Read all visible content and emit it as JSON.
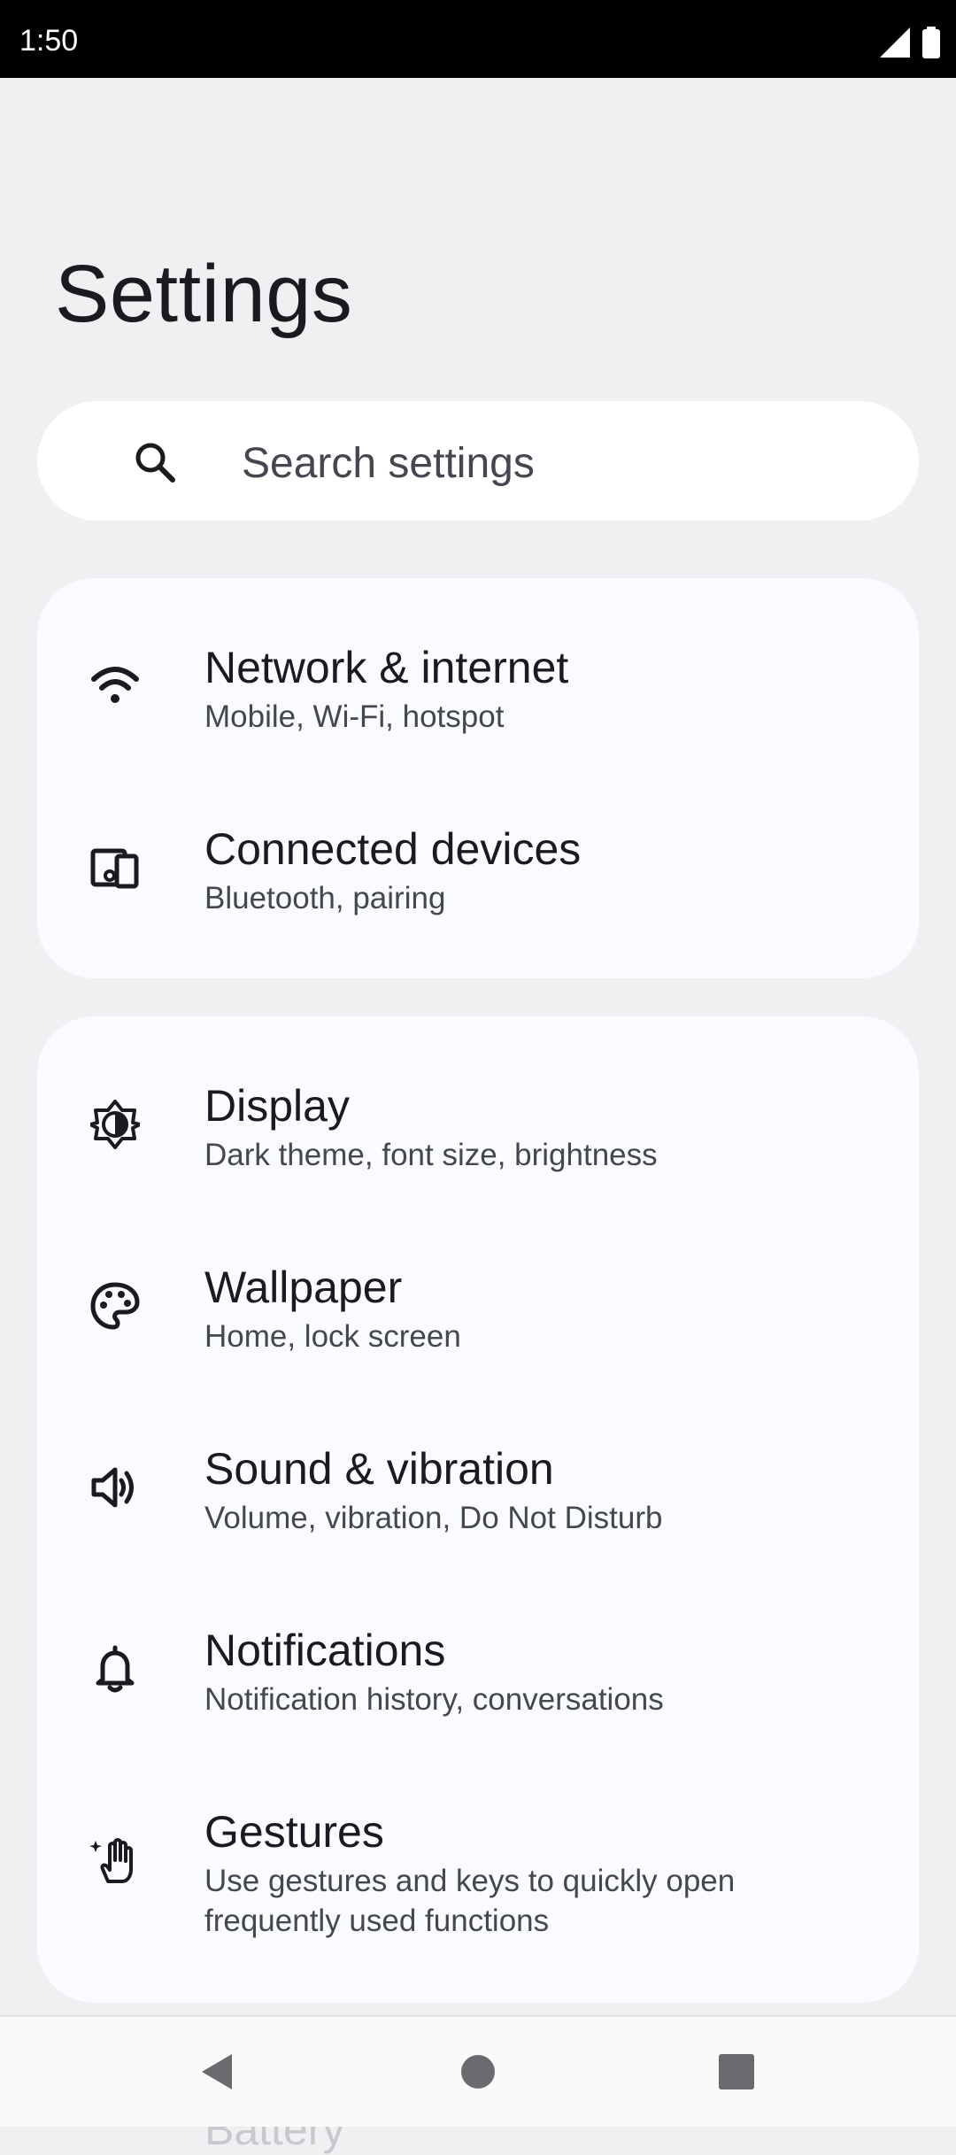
{
  "status_bar": {
    "time": "1:50",
    "icons": [
      "signal-icon",
      "battery-icon"
    ]
  },
  "page": {
    "title": "Settings"
  },
  "search": {
    "placeholder": "Search settings",
    "icon": "search-icon"
  },
  "groups": [
    {
      "items": [
        {
          "icon": "wifi-icon",
          "title": "Network & internet",
          "subtitle": "Mobile, Wi-Fi, hotspot"
        },
        {
          "icon": "devices-icon",
          "title": "Connected devices",
          "subtitle": "Bluetooth, pairing"
        }
      ]
    },
    {
      "items": [
        {
          "icon": "brightness-icon",
          "title": "Display",
          "subtitle": "Dark theme, font size, brightness"
        },
        {
          "icon": "palette-icon",
          "title": "Wallpaper",
          "subtitle": "Home, lock screen"
        },
        {
          "icon": "speaker-icon",
          "title": "Sound & vibration",
          "subtitle": "Volume, vibration, Do Not Disturb"
        },
        {
          "icon": "bell-icon",
          "title": "Notifications",
          "subtitle": "Notification history, conversations"
        },
        {
          "icon": "gesture-hand-icon",
          "title": "Gestures",
          "subtitle": "Use gestures and keys to quickly open frequently used functions"
        }
      ]
    }
  ],
  "partially_visible": {
    "title": "Battery"
  },
  "nav_bar": {
    "buttons": [
      "back-triangle-icon",
      "home-circle-icon",
      "recents-square-icon"
    ]
  },
  "colors": {
    "background": "#eff0f2",
    "card": "#fafbff",
    "text_primary": "#1b1b1f",
    "text_secondary": "#44474f",
    "status_bar": "#000000"
  }
}
